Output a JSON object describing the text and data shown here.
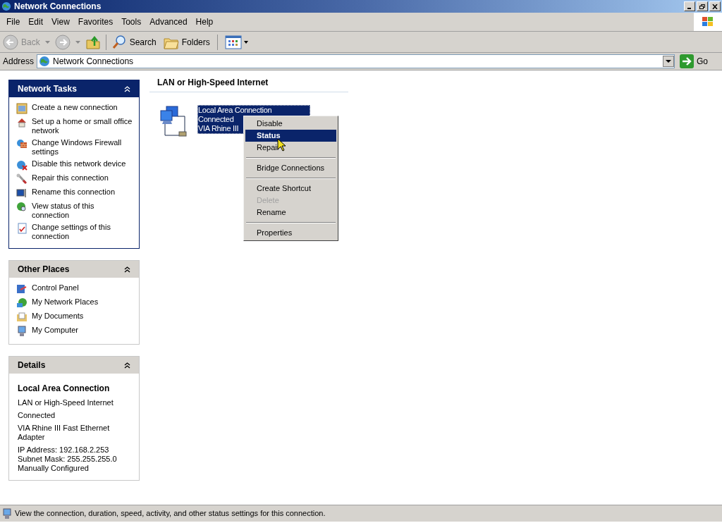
{
  "window": {
    "title": "Network Connections"
  },
  "menu_bar": [
    "File",
    "Edit",
    "View",
    "Favorites",
    "Tools",
    "Advanced",
    "Help"
  ],
  "toolbar": {
    "back": "Back",
    "search": "Search",
    "folders": "Folders"
  },
  "address_bar": {
    "label": "Address",
    "value": "Network Connections",
    "go": "Go"
  },
  "panes": [
    {
      "title": "Network Tasks",
      "kind": "tasks",
      "items": [
        "Create a new connection",
        "Set up a home or small office network",
        "Change Windows Firewall settings",
        "Disable this network device",
        "Repair this connection",
        "Rename this connection",
        "View status of this connection",
        "Change settings of this connection"
      ]
    },
    {
      "title": "Other Places",
      "kind": "places",
      "items": [
        "Control Panel",
        "My Network Places",
        "My Documents",
        "My Computer"
      ]
    },
    {
      "title": "Details",
      "kind": "details",
      "heading": "Local Area Connection",
      "groups": [
        [
          "LAN or High-Speed Internet"
        ],
        [
          "Connected"
        ],
        [
          "VIA Rhine III Fast Ethernet Adapter"
        ],
        [
          "IP Address: 192.168.2.253",
          "Subnet Mask: 255.255.255.0",
          "Manually Configured"
        ]
      ]
    }
  ],
  "group_heading": "LAN or High-Speed Internet",
  "connection": {
    "selected": true,
    "lines": [
      "Local Area Connection",
      "Connected",
      "VIA Rhine III"
    ]
  },
  "context_menu": [
    {
      "kind": "item",
      "label": "Disable",
      "selected": false,
      "disabled": false,
      "default": false
    },
    {
      "kind": "item",
      "label": "Status",
      "selected": true,
      "disabled": false,
      "default": true
    },
    {
      "kind": "item",
      "label": "Repair",
      "selected": false,
      "disabled": false,
      "default": false
    },
    {
      "kind": "separator"
    },
    {
      "kind": "item",
      "label": "Bridge Connections",
      "selected": false,
      "disabled": false,
      "default": false
    },
    {
      "kind": "separator"
    },
    {
      "kind": "item",
      "label": "Create Shortcut",
      "selected": false,
      "disabled": false,
      "default": false
    },
    {
      "kind": "item",
      "label": "Delete",
      "selected": false,
      "disabled": true,
      "default": false
    },
    {
      "kind": "item",
      "label": "Rename",
      "selected": false,
      "disabled": false,
      "default": false
    },
    {
      "kind": "separator"
    },
    {
      "kind": "item",
      "label": "Properties",
      "selected": false,
      "disabled": false,
      "default": false
    }
  ],
  "status_bar": "View the connection, duration, speed, activity, and other status settings for this connection."
}
